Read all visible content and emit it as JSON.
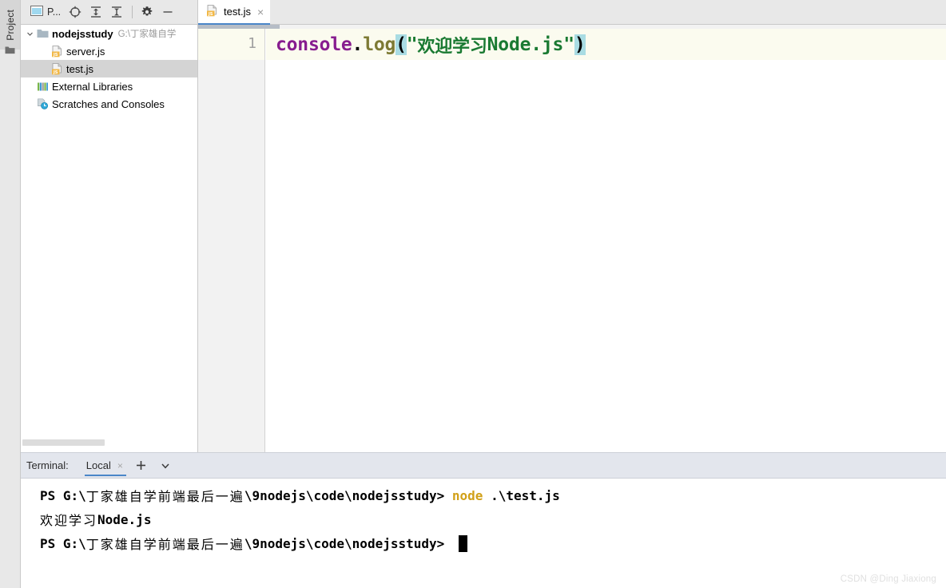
{
  "window": {
    "tool_strip": {
      "project_tab_label": "Project",
      "folder_icon": "folder-icon"
    }
  },
  "project_toolbar": {
    "project_selector_label": "P...",
    "project_selector_icon": "project-window-icon",
    "locate_icon": "locate-target-icon",
    "expand_all_icon": "expand-all-icon",
    "collapse_all_icon": "collapse-all-icon",
    "settings_icon": "gear-icon",
    "hide_icon": "minimize-icon"
  },
  "project_tree": {
    "items": [
      {
        "label": "nodejsstudy",
        "sublabel": "G:\\丁家雄自学",
        "icon": "folder-icon",
        "arrow": "chevron-down-icon",
        "indent": 0,
        "bold": true,
        "selected": false
      },
      {
        "label": "server.js",
        "sublabel": "",
        "icon": "js-file-icon",
        "arrow": "",
        "indent": 1,
        "bold": false,
        "selected": false
      },
      {
        "label": "test.js",
        "sublabel": "",
        "icon": "js-file-icon",
        "arrow": "",
        "indent": 1,
        "bold": false,
        "selected": true
      },
      {
        "label": "External Libraries",
        "sublabel": "",
        "icon": "libraries-icon",
        "arrow": "",
        "indent": 0,
        "bold": false,
        "selected": false
      },
      {
        "label": "Scratches and Consoles",
        "sublabel": "",
        "icon": "scratches-icon",
        "arrow": "",
        "indent": 0,
        "bold": false,
        "selected": false
      }
    ]
  },
  "editor": {
    "tab": {
      "label": "test.js",
      "icon": "js-file-icon",
      "close_label": "×"
    },
    "line_number": "1",
    "code_tokens": [
      {
        "text": "console",
        "kind": "obj"
      },
      {
        "text": ".",
        "kind": "dot"
      },
      {
        "text": "log",
        "kind": "fn"
      },
      {
        "text": "(",
        "kind": "paren"
      },
      {
        "text": "\"",
        "kind": "str"
      },
      {
        "text": "欢迎学习",
        "kind": "cn"
      },
      {
        "text": "Node.js",
        "kind": "str"
      },
      {
        "text": "\"",
        "kind": "str"
      },
      {
        "text": ")",
        "kind": "paren"
      }
    ],
    "code_plain": "console.log(\"欢迎学习Node.js\")"
  },
  "terminal": {
    "title": "Terminal:",
    "tab_label": "Local",
    "tab_close_label": "×",
    "add_tab_label": "+",
    "options_icon": "chevron-down-icon",
    "lines": [
      {
        "type": "prompt",
        "segments": [
          {
            "text": "PS G:\\",
            "kind": "mono"
          },
          {
            "text": "丁家雄自学前端最后一遍",
            "kind": "cn"
          },
          {
            "text": "\\9nodejs\\code\\nodejsstudy> ",
            "kind": "mono"
          },
          {
            "text": "node",
            "kind": "cmd"
          },
          {
            "text": " .\\test.js",
            "kind": "arg"
          }
        ]
      },
      {
        "type": "output",
        "segments": [
          {
            "text": "欢迎学习",
            "kind": "cn"
          },
          {
            "text": "Node.js",
            "kind": "mono"
          }
        ]
      },
      {
        "type": "prompt",
        "segments": [
          {
            "text": "PS G:\\",
            "kind": "mono"
          },
          {
            "text": "丁家雄自学前端最后一遍",
            "kind": "cn"
          },
          {
            "text": "\\9nodejs\\code\\nodejsstudy> ",
            "kind": "mono"
          },
          {
            "text": "",
            "kind": "cursor"
          }
        ]
      }
    ]
  },
  "watermark": {
    "text": "CSDN @Ding Jiaxiong"
  },
  "colors": {
    "accent_blue": "#4a86c8",
    "toolbar_bg": "#e8e8e8",
    "terminal_header_bg": "#e3e6ed",
    "selection_gray": "#d4d4d4",
    "current_line": "#fbfbef",
    "bracket_highlight": "#a9dce3",
    "string_green": "#1a7a32",
    "object_purple": "#871d8f",
    "function_olive": "#7d7a34",
    "command_yellow": "#d1a018"
  }
}
